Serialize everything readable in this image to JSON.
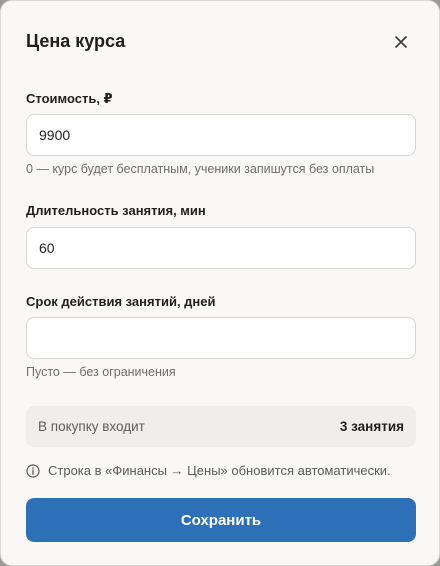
{
  "dialog": {
    "title": "Цена курса",
    "close_icon": "close-icon"
  },
  "price": {
    "label": "Стоимость, ₽",
    "value": "9900",
    "hint": "0 — курс будет бесплатным, ученики запишутся без оплаты"
  },
  "duration": {
    "label": "Длительность занятия, мин",
    "value": "60"
  },
  "validity": {
    "label": "Срок действия занятий, дней",
    "value": "",
    "hint": "Пусто — без ограничения"
  },
  "summary": {
    "label": "В покупку входит",
    "value": "3 занятия"
  },
  "info": {
    "icon": "info-icon",
    "text": "Строка в «Финансы → Цены» обновится автоматически."
  },
  "save_button": {
    "label": "Сохранить"
  },
  "colors": {
    "primary": "#2e70b8",
    "background": "#f9f8f6",
    "summary_bg": "#efeeeb"
  }
}
